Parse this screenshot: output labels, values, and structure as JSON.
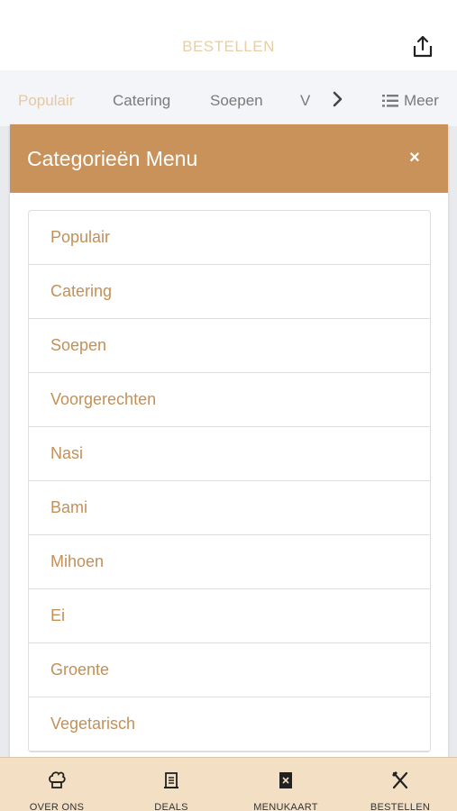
{
  "header": {
    "title": "BESTELLEN",
    "share_icon": "share-icon"
  },
  "tabs": {
    "items": [
      "Populair",
      "Catering",
      "Soepen",
      "V"
    ],
    "more_label": "Meer"
  },
  "modal": {
    "title": "Categorieën Menu",
    "close": "×",
    "items": [
      "Populair",
      "Catering",
      "Soepen",
      "Voorgerechten",
      "Nasi",
      "Bami",
      "Mihoen",
      "Ei",
      "Groente",
      "Vegetarisch"
    ]
  },
  "bottom_nav": {
    "items": [
      "OVER ONS",
      "DEALS",
      "MENUKAART",
      "BESTELLEN"
    ]
  },
  "colors": {
    "accent": "#c9925a",
    "item_text": "#c29058",
    "nav_bg": "#f3dfc4"
  }
}
